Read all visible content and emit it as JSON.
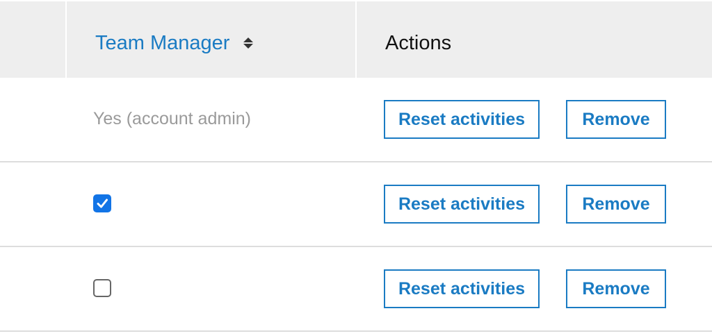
{
  "header": {
    "team_manager_label": "Team Manager",
    "actions_label": "Actions",
    "sort_icon": "sort-up-down-icon"
  },
  "rows": [
    {
      "team_manager": "Yes (account admin)",
      "reset_label": "Reset activities",
      "remove_label": "Remove"
    },
    {
      "team_manager_checked": true,
      "reset_label": "Reset activities",
      "remove_label": "Remove"
    },
    {
      "team_manager_checked": false,
      "reset_label": "Reset activities",
      "remove_label": "Remove"
    }
  ],
  "colors": {
    "accent": "#1a7bc3",
    "checkbox_checked": "#1274e6",
    "header_bg": "#eeeeee",
    "muted_text": "#9a9a9a"
  }
}
